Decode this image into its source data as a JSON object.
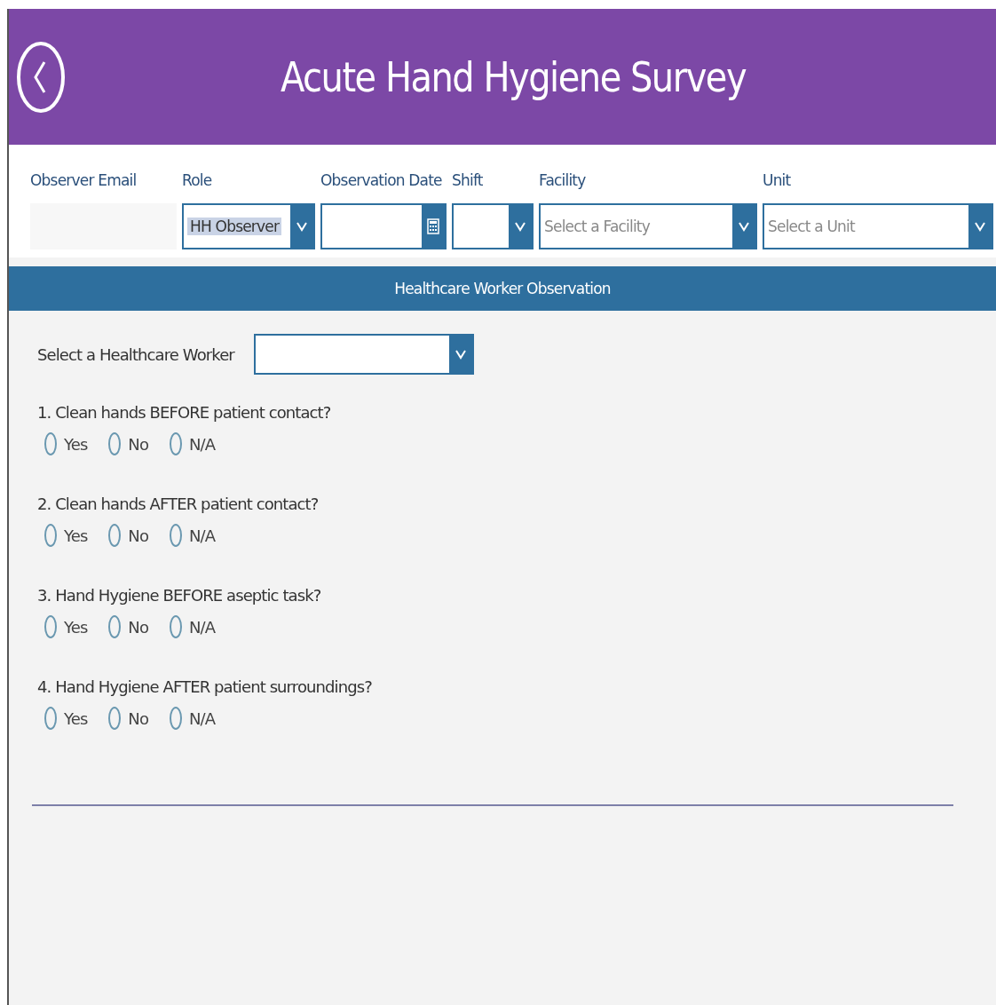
{
  "header": {
    "title": "Acute Hand Hygiene Survey"
  },
  "fields": [
    {
      "label": "Observer Email",
      "kind": "text"
    },
    {
      "label": "Role",
      "kind": "dropdown",
      "value": "HH Observer",
      "highlighted": true
    },
    {
      "label": "Observation Date",
      "kind": "date"
    },
    {
      "label": "Shift",
      "kind": "dropdown"
    },
    {
      "label": "Facility",
      "kind": "dropdown",
      "placeholder": "Select a Facility"
    },
    {
      "label": "Unit",
      "kind": "dropdown",
      "placeholder": "Select a Unit"
    }
  ],
  "section": {
    "title": "Healthcare Worker Observation"
  },
  "worker": {
    "label": "Select a Healthcare Worker"
  },
  "questions": [
    {
      "text": "1. Clean hands BEFORE patient contact?",
      "options": [
        {
          "label": "Yes",
          "selected": false
        },
        {
          "label": "No",
          "selected": false
        },
        {
          "label": "N/A",
          "selected": false
        }
      ]
    },
    {
      "text": "2. Clean hands AFTER patient contact?",
      "options": [
        {
          "label": "Yes",
          "selected": false
        },
        {
          "label": "No",
          "selected": false
        },
        {
          "label": "N/A",
          "selected": false
        }
      ]
    },
    {
      "text": "3. Hand Hygiene BEFORE aseptic task?",
      "options": [
        {
          "label": "Yes",
          "selected": false
        },
        {
          "label": "No",
          "selected": false
        },
        {
          "label": "N/A",
          "selected": false
        }
      ]
    },
    {
      "text": "4. Hand Hygiene AFTER patient surroundings?",
      "options": [
        {
          "label": "Yes",
          "selected": false
        },
        {
          "label": "No",
          "selected": false
        },
        {
          "label": "N/A",
          "selected": false
        }
      ]
    }
  ]
}
